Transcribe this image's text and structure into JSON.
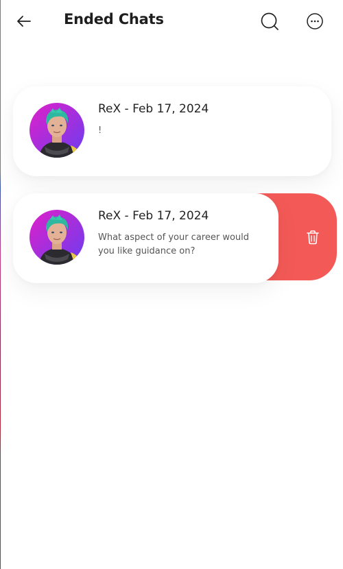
{
  "header": {
    "title": "Ended Chats",
    "back_icon": "arrow-left-icon",
    "search_icon": "search-icon",
    "more_icon": "more-horizontal-icon"
  },
  "chats": [
    {
      "name": "ReX - Feb 17, 2024",
      "preview": "!",
      "avatar": "rex-avatar"
    },
    {
      "name": "ReX - Feb 17, 2024",
      "preview": "What aspect of your career would you like guidance on?",
      "avatar": "rex-avatar",
      "swipe_action": {
        "icon": "trash-icon",
        "color": "#f35a57"
      }
    }
  ],
  "colors": {
    "title": "#1e1e1e",
    "delete_bg": "#f35a57",
    "avatar_gradient_start": "#e020c8",
    "avatar_gradient_end": "#6a3df0"
  }
}
